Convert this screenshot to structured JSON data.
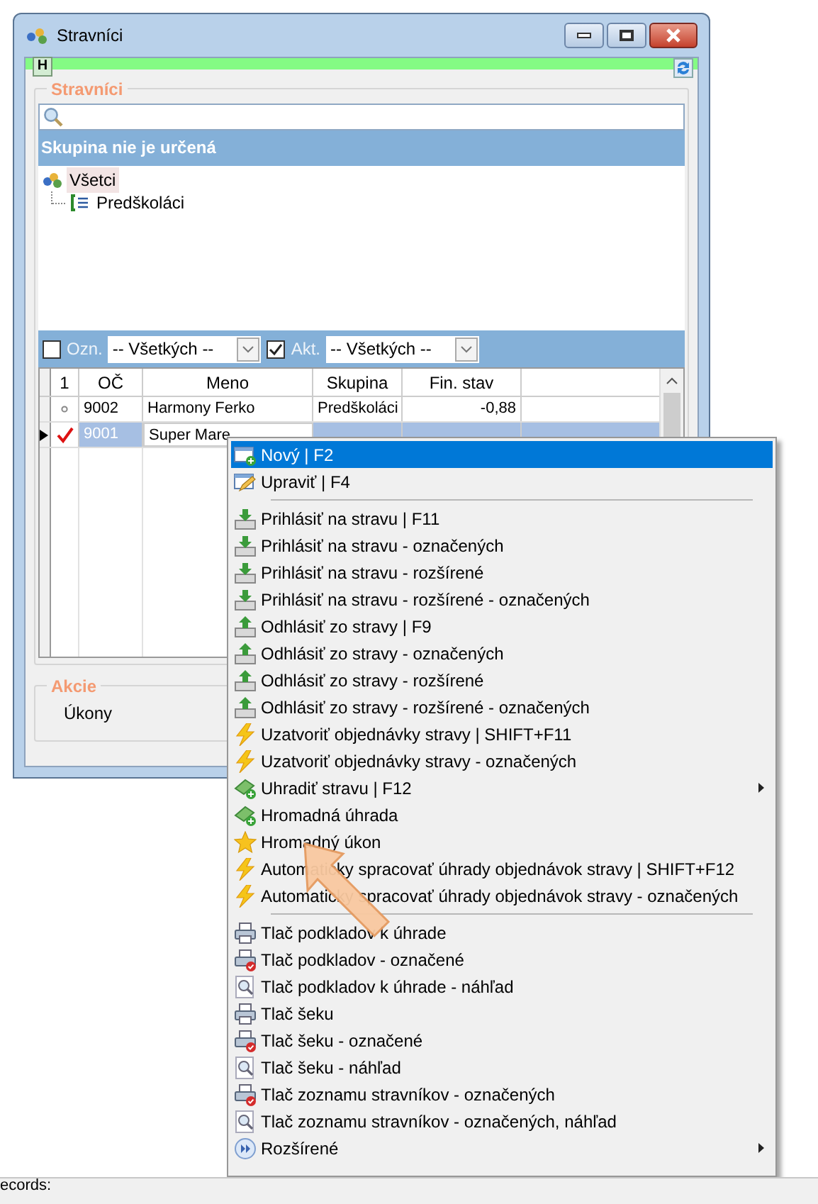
{
  "window": {
    "title": "Stravníci"
  },
  "toolbar": {
    "h_button": "H"
  },
  "group": {
    "title": "Stravníci",
    "tree_header": "Skupina nie je určená",
    "tree": [
      {
        "label": "Všetci",
        "selected": true,
        "children": [
          {
            "label": "Predškoláci",
            "selected": false
          }
        ]
      }
    ]
  },
  "filters": [
    {
      "label": "Ozn.",
      "checked": false,
      "value": "-- Všetkých --"
    },
    {
      "label": "Akt.",
      "checked": true,
      "value": "-- Všetkých --"
    }
  ],
  "table": {
    "columns": [
      "1",
      "OČ",
      "Meno",
      "Skupina",
      "Fin. stav"
    ],
    "rows": [
      {
        "marked": false,
        "selected": false,
        "oc": "9002",
        "meno": "Harmony Ferko",
        "skupina": "Predškoláci",
        "fin_stav": "-0,88"
      },
      {
        "marked": true,
        "selected": true,
        "oc": "9001",
        "meno": "Super Mare"
      }
    ]
  },
  "actions": {
    "title": "Akcie",
    "button": "Úkony"
  },
  "context_menu": [
    {
      "kind": "new",
      "label": "Nový | F2",
      "selected": true
    },
    {
      "kind": "edit",
      "label": "Upraviť | F4",
      "selected": false
    },
    {
      "kind": "separator"
    },
    {
      "kind": "login",
      "label": "Prihlásiť na stravu | F11",
      "selected": false
    },
    {
      "kind": "login",
      "label": "Prihlásiť na stravu - označených",
      "selected": false
    },
    {
      "kind": "login",
      "label": "Prihlásiť na stravu - rozšírené",
      "selected": false
    },
    {
      "kind": "login",
      "label": "Prihlásiť na stravu - rozšírené - označených",
      "selected": false
    },
    {
      "kind": "logout",
      "label": "Odhlásiť zo stravy | F9",
      "selected": false
    },
    {
      "kind": "logout",
      "label": "Odhlásiť zo stravy - označených",
      "selected": false
    },
    {
      "kind": "logout",
      "label": "Odhlásiť zo stravy - rozšírené",
      "selected": false
    },
    {
      "kind": "logout",
      "label": "Odhlásiť zo stravy - rozšírené - označených",
      "selected": false
    },
    {
      "kind": "bolt",
      "label": "Uzatvoriť objednávky stravy | SHIFT+F11",
      "selected": false
    },
    {
      "kind": "bolt",
      "label": "Uzatvoriť objednávky stravy - označených",
      "selected": false
    },
    {
      "kind": "money",
      "label": "Uhradiť stravu | F12",
      "selected": false,
      "submenu": true
    },
    {
      "kind": "money",
      "label": "Hromadná úhrada",
      "selected": false
    },
    {
      "kind": "star",
      "label": "Hromadný úkon",
      "selected": false
    },
    {
      "kind": "bolt",
      "label": "Automaticky spracovať úhrady objednávok stravy | SHIFT+F12",
      "selected": false
    },
    {
      "kind": "bolt",
      "label": "Automaticky spracovať úhrady objednávok stravy - označených",
      "selected": false
    },
    {
      "kind": "separator"
    },
    {
      "kind": "print",
      "label": "Tlač podkladov k úhrade",
      "selected": false
    },
    {
      "kind": "print_marked",
      "label": "Tlač podkladov - označené",
      "selected": false
    },
    {
      "kind": "preview",
      "label": "Tlač podkladov k úhrade - náhľad",
      "selected": false
    },
    {
      "kind": "print",
      "label": "Tlač šeku",
      "selected": false
    },
    {
      "kind": "print_marked",
      "label": "Tlač šeku - označené",
      "selected": false
    },
    {
      "kind": "preview",
      "label": "Tlač šeku - náhľad",
      "selected": false
    },
    {
      "kind": "print_marked",
      "label": "Tlač zoznamu stravníkov - označených",
      "selected": false
    },
    {
      "kind": "preview",
      "label": "Tlač zoznamu stravníkov - označených, náhľad",
      "selected": false
    },
    {
      "kind": "more",
      "label": "Rozšírené",
      "selected": false,
      "submenu": true
    }
  ],
  "status_bar": {
    "text": "ecords:"
  }
}
